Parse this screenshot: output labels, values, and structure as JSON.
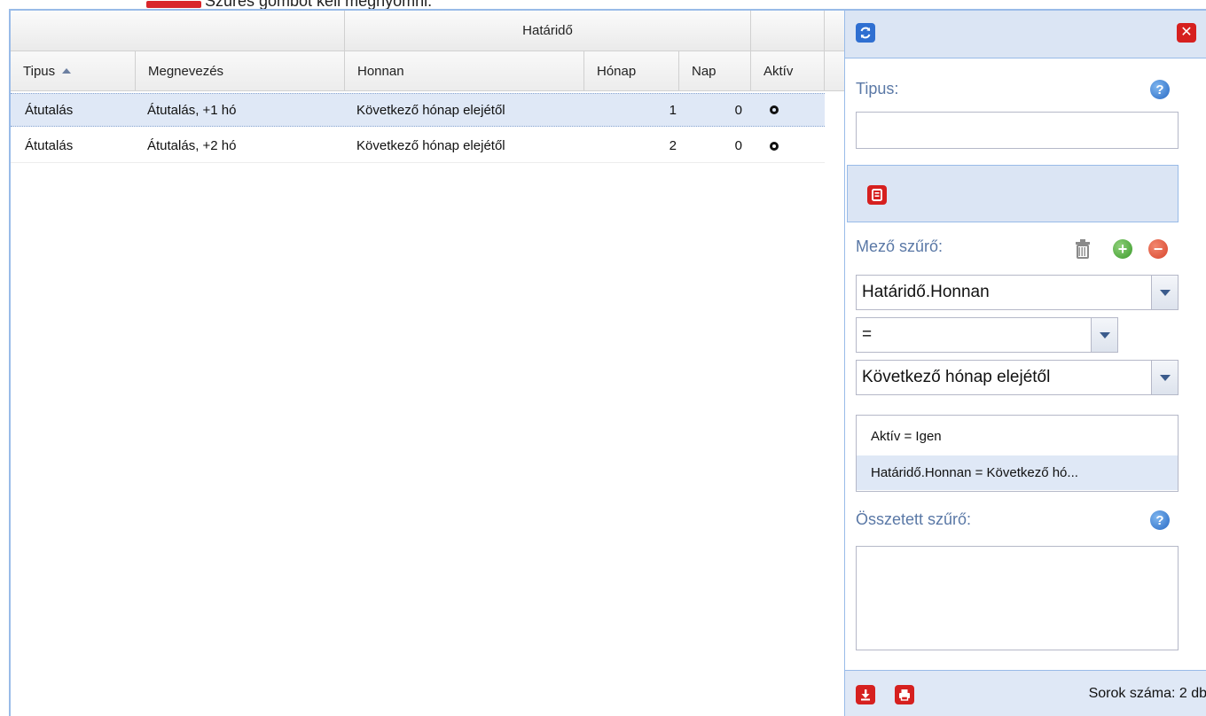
{
  "caption": {
    "text": "Szűrés gombot kell megnyomni."
  },
  "grid": {
    "group_header": "Határidő",
    "columns": {
      "tipus": "Tipus",
      "megnevezes": "Megnevezés",
      "honnan": "Honnan",
      "honap": "Hónap",
      "nap": "Nap",
      "aktiv": "Aktív"
    },
    "sort": {
      "column": "Tipus",
      "direction": "ascending"
    },
    "rows": [
      {
        "tipus": "Átutalás",
        "megnevezes": "Átutalás, +1 hó",
        "honnan": "Következő hónap elejétől",
        "honap": "1",
        "nap": "0",
        "aktiv": "active",
        "selected": true
      },
      {
        "tipus": "Átutalás",
        "megnevezes": "Átutalás, +2 hó",
        "honnan": "Következő hónap elejétől",
        "honap": "2",
        "nap": "0",
        "aktiv": "active",
        "selected": false
      }
    ]
  },
  "panel": {
    "tipus_label": "Tipus:",
    "tipus_value": "",
    "field_filter_label": "Mező szűrő:",
    "field_select": "Határidő.Honnan",
    "operator_select": "=",
    "value_select": "Következő hónap elejétől",
    "filters": [
      "Aktív = Igen",
      "Határidő.Honnan = Következő hó..."
    ],
    "compound_filter_label": "Összetett szűrő:",
    "compound_filter_value": "",
    "row_count": "Sorok száma: 2 db"
  },
  "icons": {
    "refresh": "refresh-icon",
    "close": "close-icon",
    "filter_toolbar": "document-icon",
    "help": "help-icon",
    "trash": "trash-icon",
    "add": "plus-icon",
    "remove": "minus-icon",
    "download": "download-icon",
    "print": "print-icon"
  },
  "colors": {
    "accent_blue": "#99bbe8",
    "selected_row": "#dfe8f6",
    "label_blue": "#5a78a6",
    "red_button": "#d6201f"
  }
}
